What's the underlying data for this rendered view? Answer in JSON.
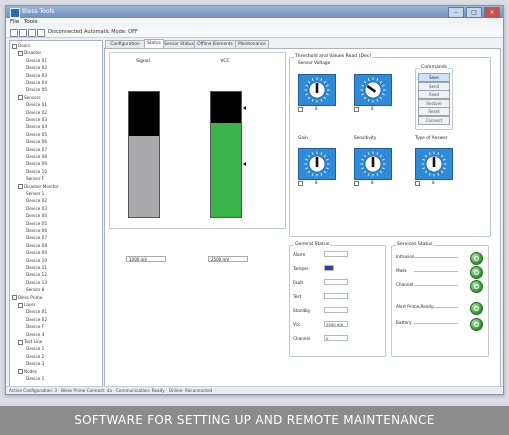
{
  "window": {
    "title": "Bless Tools"
  },
  "menu": [
    "File",
    "Tools"
  ],
  "toolbar": {
    "connection_label": "Disconnected",
    "mode_label": "Automatic Mode: OFF"
  },
  "tree": [
    {
      "label": "Doors",
      "level": 0
    },
    {
      "label": "Disaster",
      "level": 1
    },
    {
      "label": "Device 01",
      "level": 2
    },
    {
      "label": "Device 02",
      "level": 2
    },
    {
      "label": "Device 03",
      "level": 2
    },
    {
      "label": "Device 04",
      "level": 2
    },
    {
      "label": "Device 05",
      "level": 2
    },
    {
      "label": "Sensors",
      "level": 1
    },
    {
      "label": "Device 01",
      "level": 2
    },
    {
      "label": "Device 02",
      "level": 2
    },
    {
      "label": "Device 03",
      "level": 2
    },
    {
      "label": "Device 04",
      "level": 2
    },
    {
      "label": "Device 05",
      "level": 2
    },
    {
      "label": "Device 06",
      "level": 2
    },
    {
      "label": "Device 07",
      "level": 2
    },
    {
      "label": "Device 08",
      "level": 2
    },
    {
      "label": "Device 09",
      "level": 2
    },
    {
      "label": "Device 10",
      "level": 2
    },
    {
      "label": "Sensor F",
      "level": 2
    },
    {
      "label": "Disaster Monitor",
      "level": 1
    },
    {
      "label": "Sensor 1",
      "level": 2
    },
    {
      "label": "Device 02",
      "level": 2
    },
    {
      "label": "Device 03",
      "level": 2
    },
    {
      "label": "Device 04",
      "level": 2
    },
    {
      "label": "Device 05",
      "level": 2
    },
    {
      "label": "Device 06",
      "level": 2
    },
    {
      "label": "Device 07",
      "level": 2
    },
    {
      "label": "Device 08",
      "level": 2
    },
    {
      "label": "Device 09",
      "level": 2
    },
    {
      "label": "Device 10",
      "level": 2
    },
    {
      "label": "Device 11",
      "level": 2
    },
    {
      "label": "Device 12",
      "level": 2
    },
    {
      "label": "Device 13",
      "level": 2
    },
    {
      "label": "Sensor 8",
      "level": 2
    },
    {
      "label": "Bless Prime",
      "level": 0
    },
    {
      "label": "Laser",
      "level": 1
    },
    {
      "label": "Device 01",
      "level": 2
    },
    {
      "label": "Device 02",
      "level": 2
    },
    {
      "label": "Device F",
      "level": 2
    },
    {
      "label": "Device 4",
      "level": 2
    },
    {
      "label": "Test Line",
      "level": 1
    },
    {
      "label": "Device 1",
      "level": 2
    },
    {
      "label": "Device 2",
      "level": 2
    },
    {
      "label": "Device 3",
      "level": 2
    },
    {
      "label": "Nodes",
      "level": 1
    },
    {
      "label": "Device 1",
      "level": 2
    }
  ],
  "tabs": [
    {
      "label": "Configuration",
      "active": false
    },
    {
      "label": "Status",
      "active": true
    },
    {
      "label": "Sensor Status",
      "active": false
    },
    {
      "label": "Offline Elements",
      "active": false
    },
    {
      "label": "Maintenance",
      "active": false
    }
  ],
  "bars": [
    {
      "label": "Signal",
      "value_text": "1000 mV",
      "top_fraction": 0.35,
      "bottom_fraction": 0.65,
      "bottom_color": "#a9a9ab",
      "marker": false
    },
    {
      "label": "VCC",
      "value_text": "2500 mV",
      "top_fraction": 0.25,
      "bottom_fraction": 0.75,
      "bottom_color": "#3ab34a",
      "marker": true
    }
  ],
  "threshold_group": {
    "title": "Threshold and Values Read (Dec)"
  },
  "dials": [
    {
      "label": "Sensor Voltage",
      "value": "8",
      "angle": 0
    },
    {
      "label": "",
      "value": "8",
      "angle": -55
    },
    {
      "label": "Gain",
      "value": "8",
      "angle": 0
    },
    {
      "label": "Sensitivity",
      "value": "8",
      "angle": 0
    },
    {
      "label": "Type of Answer",
      "value": "8",
      "angle": 0
    }
  ],
  "commands": {
    "title": "Commands",
    "buttons": [
      "Save",
      "Send",
      "Read",
      "Restore",
      "Reset",
      "Connect"
    ]
  },
  "general_status": {
    "title": "General Status",
    "rows": [
      {
        "label": "Alarm",
        "value": ""
      },
      {
        "label": "Tamper",
        "value": ""
      },
      {
        "label": "Fault",
        "value": ""
      },
      {
        "label": "Test",
        "value": ""
      },
      {
        "label": "Standby",
        "value": ""
      },
      {
        "label": "Vcc",
        "value": "2500 mV"
      },
      {
        "label": "Channel",
        "value": "0"
      }
    ]
  },
  "service_status": {
    "title": "Services Status",
    "rows": [
      "Intrusion",
      "Mask",
      "Channel",
      "Alert Prime Ready",
      "Battery"
    ]
  },
  "statusbar": {
    "text": "Active Configuration: 3 · Bless Prime Connect: 4a · Communication: Ready · Online: Reconnected"
  },
  "banner": {
    "text": "SOFTWARE FOR SETTING UP AND REMOTE MAINTENANCE"
  },
  "colors": {
    "accent": "#2f8ad9",
    "led": "#3fa63a",
    "banner": "#8c8c8c"
  }
}
